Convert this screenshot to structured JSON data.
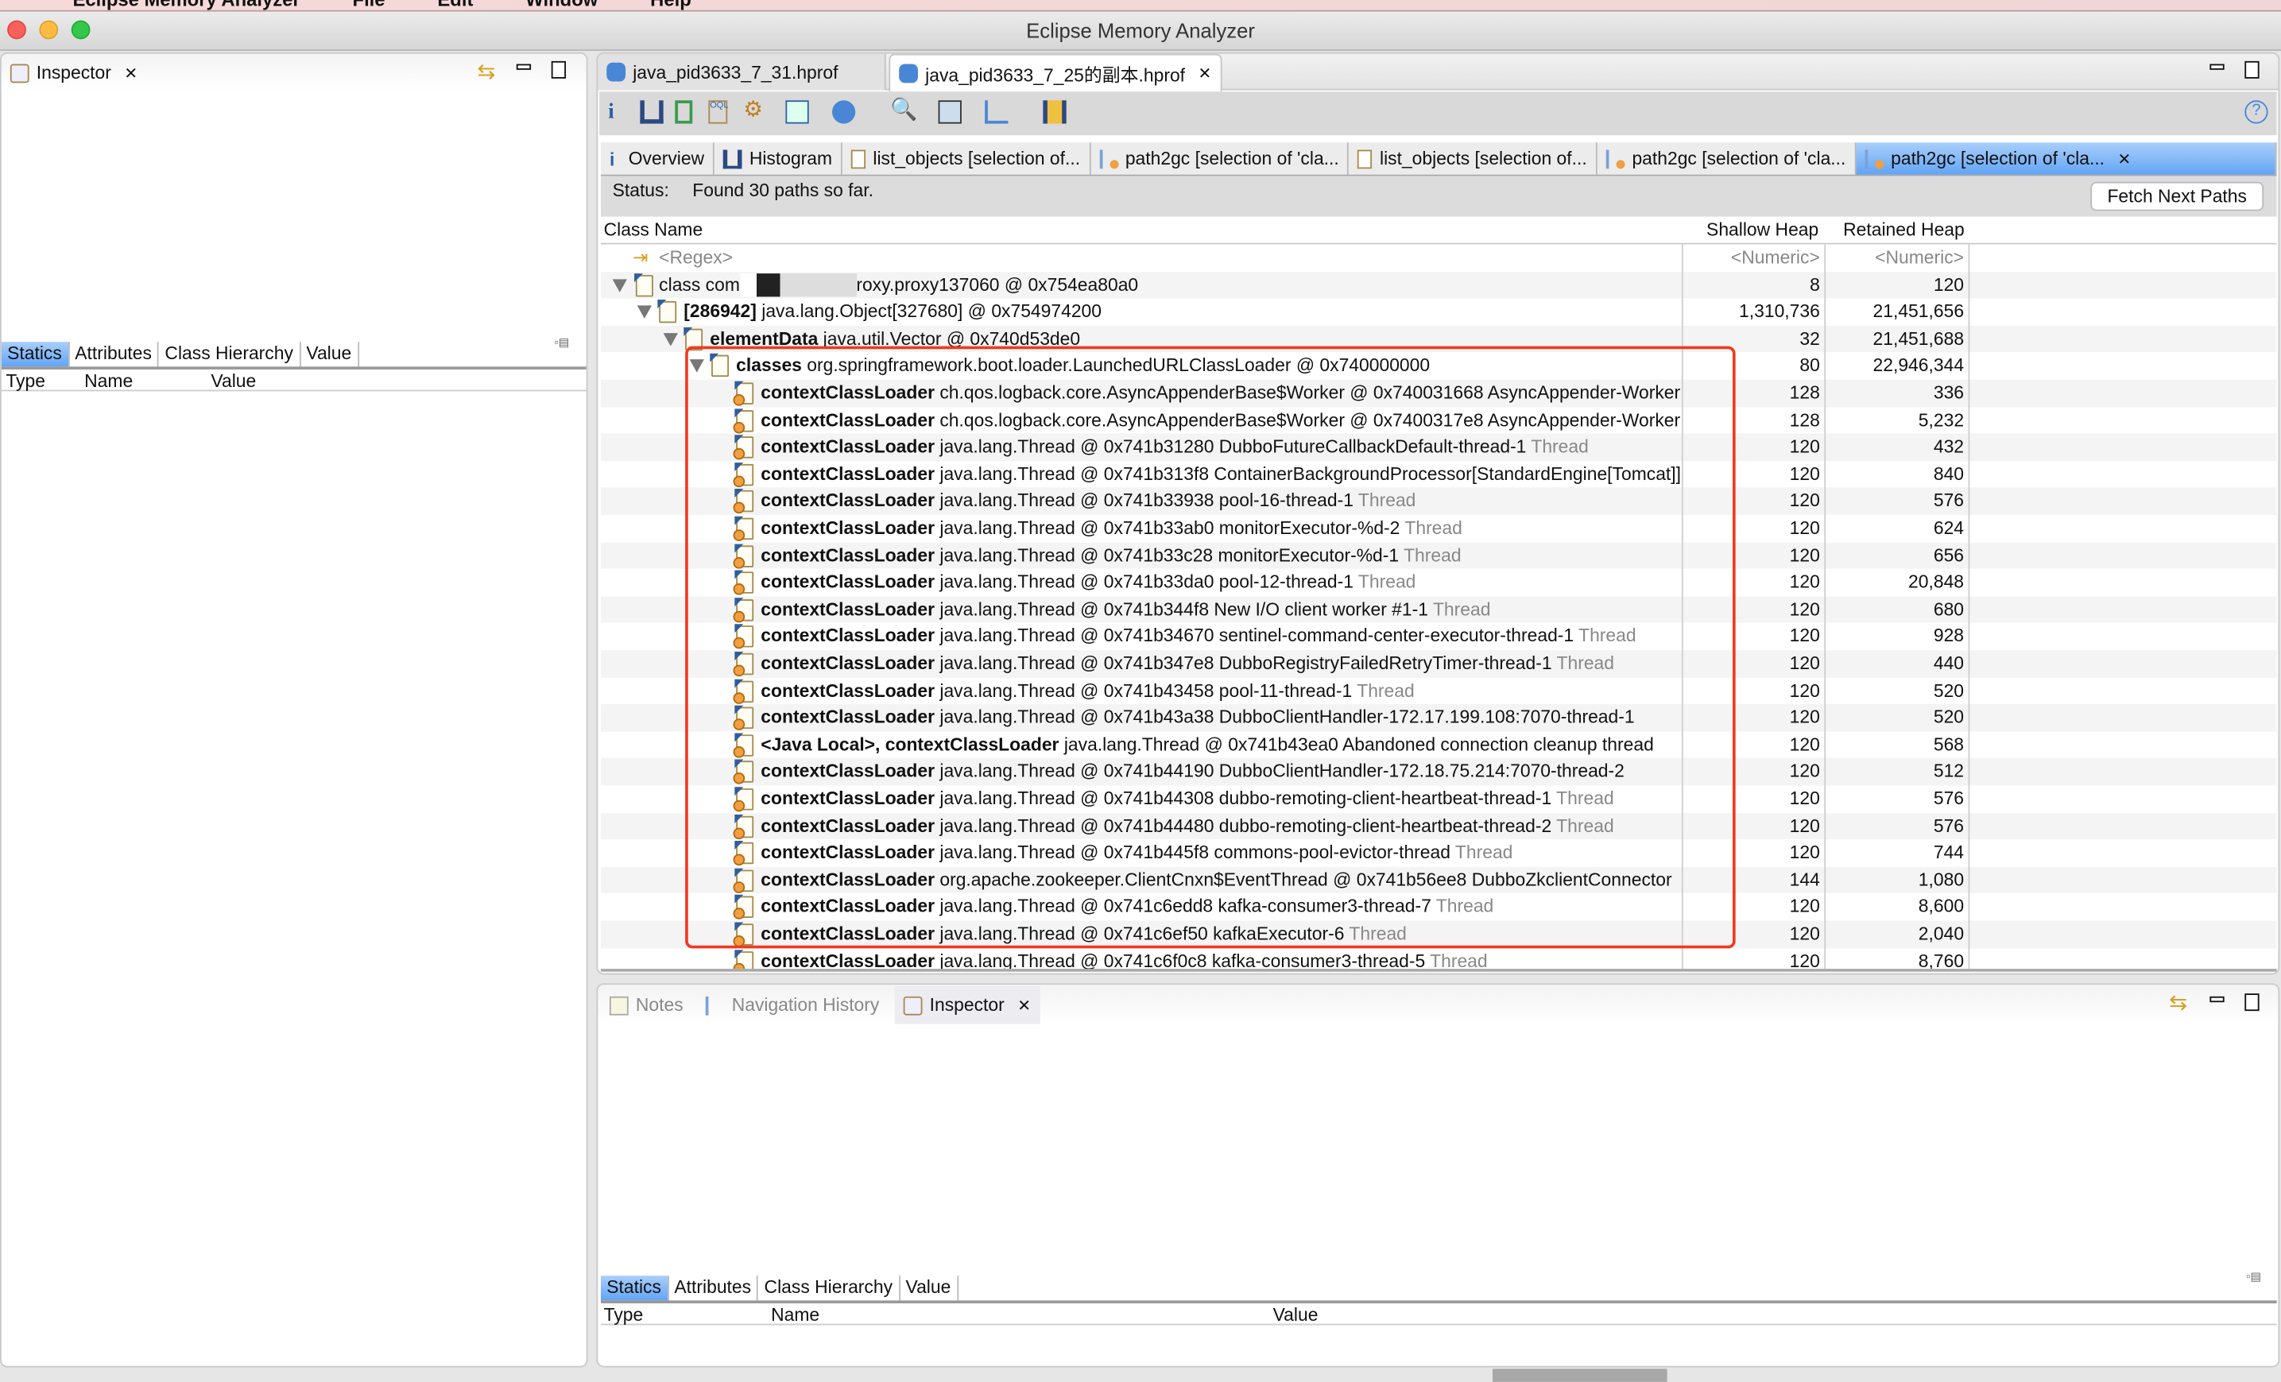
{
  "menubar": {
    "items": [
      "Eclipse Memory Analyzer",
      "File",
      "Edit",
      "Window",
      "Help"
    ]
  },
  "window": {
    "title": "Eclipse Memory Analyzer"
  },
  "left_panel": {
    "tab": "Inspector",
    "subtabs": [
      "Statics",
      "Attributes",
      "Class Hierarchy",
      "Value"
    ],
    "columns": [
      "Type",
      "Name",
      "Value"
    ]
  },
  "editor": {
    "tabs": [
      {
        "label": "java_pid3633_7_31.hprof",
        "active": false
      },
      {
        "label": "java_pid3633_7_25的副本.hprof",
        "active": true
      }
    ],
    "toolbar": [
      "info-icon",
      "histogram-icon",
      "dominator-tree-icon",
      "oql-icon",
      "heap-dump-overview-icon",
      "query-browser-icon",
      "object-query-icon",
      "search-icon",
      "calculator-icon",
      "export-icon",
      "leak-suspects-icon",
      "help-icon"
    ],
    "result_tabs": [
      {
        "label": "Overview",
        "icon": "info-icon"
      },
      {
        "label": "Histogram",
        "icon": "histogram-icon"
      },
      {
        "label": "list_objects  [selection of...",
        "icon": "list-icon"
      },
      {
        "label": "path2gc  [selection of 'cla...",
        "icon": "path-icon"
      },
      {
        "label": "list_objects  [selection of...",
        "icon": "list-icon"
      },
      {
        "label": "path2gc  [selection of 'cla...",
        "icon": "path-icon"
      },
      {
        "label": "path2gc  [selection of 'cla...",
        "icon": "path-icon",
        "active": true
      }
    ],
    "status_label": "Status:",
    "status_text": "Found 30 paths so far.",
    "fetch_button": "Fetch Next Paths",
    "columns": {
      "name": "Class Name",
      "shallow": "Shallow Heap",
      "retained": "Retained Heap"
    },
    "filter": {
      "name": "<Regex>",
      "shallow": "<Numeric>",
      "retained": "<Numeric>"
    },
    "rows": [
      {
        "level": 0,
        "toggle": true,
        "icon": "class",
        "bold": "",
        "text": "class com",
        "redacted": true,
        "text2": "roxy.proxy137060 @ 0x754ea80a0",
        "gray": "",
        "shallow": "8",
        "retained": "120"
      },
      {
        "level": 1,
        "toggle": true,
        "icon": "array",
        "bold": "[286942]",
        "text": " java.lang.Object[327680] @ 0x754974200",
        "gray": "",
        "shallow": "1,310,736",
        "retained": "21,451,656"
      },
      {
        "level": 2,
        "toggle": true,
        "icon": "obj",
        "bold": "elementData",
        "text": " java.util.Vector @ 0x740d53de0",
        "gray": "",
        "shallow": "32",
        "retained": "21,451,688"
      },
      {
        "level": 3,
        "toggle": true,
        "icon": "loader",
        "bold": "classes",
        "text": " org.springframework.boot.loader.LaunchedURLClassLoader @ 0x740000000",
        "gray": "",
        "shallow": "80",
        "retained": "22,946,344"
      },
      {
        "level": 4,
        "bold": "contextClassLoader",
        "text": " ch.qos.logback.core.AsyncAppenderBase$Worker @ 0x740031668  AsyncAppender-Worker",
        "gray": "",
        "shallow": "128",
        "retained": "336"
      },
      {
        "level": 4,
        "bold": "contextClassLoader",
        "text": " ch.qos.logback.core.AsyncAppenderBase$Worker @ 0x7400317e8  AsyncAppender-Worker",
        "gray": "",
        "shallow": "128",
        "retained": "5,232"
      },
      {
        "level": 4,
        "bold": "contextClassLoader",
        "text": " java.lang.Thread @ 0x741b31280  DubboFutureCallbackDefault-thread-1 ",
        "gray": "Thread",
        "shallow": "120",
        "retained": "432"
      },
      {
        "level": 4,
        "bold": "contextClassLoader",
        "text": " java.lang.Thread @ 0x741b313f8  ContainerBackgroundProcessor[StandardEngine[Tomcat]]",
        "gray": "",
        "shallow": "120",
        "retained": "840"
      },
      {
        "level": 4,
        "bold": "contextClassLoader",
        "text": " java.lang.Thread @ 0x741b33938  pool-16-thread-1 ",
        "gray": "Thread",
        "shallow": "120",
        "retained": "576"
      },
      {
        "level": 4,
        "bold": "contextClassLoader",
        "text": " java.lang.Thread @ 0x741b33ab0  monitorExecutor-%d-2 ",
        "gray": "Thread",
        "shallow": "120",
        "retained": "624"
      },
      {
        "level": 4,
        "bold": "contextClassLoader",
        "text": " java.lang.Thread @ 0x741b33c28  monitorExecutor-%d-1 ",
        "gray": "Thread",
        "shallow": "120",
        "retained": "656"
      },
      {
        "level": 4,
        "bold": "contextClassLoader",
        "text": " java.lang.Thread @ 0x741b33da0  pool-12-thread-1 ",
        "gray": "Thread",
        "shallow": "120",
        "retained": "20,848"
      },
      {
        "level": 4,
        "bold": "contextClassLoader",
        "text": " java.lang.Thread @ 0x741b344f8  New I/O client worker #1-1 ",
        "gray": "Thread",
        "shallow": "120",
        "retained": "680"
      },
      {
        "level": 4,
        "bold": "contextClassLoader",
        "text": " java.lang.Thread @ 0x741b34670  sentinel-command-center-executor-thread-1 ",
        "gray": "Thread",
        "shallow": "120",
        "retained": "928"
      },
      {
        "level": 4,
        "bold": "contextClassLoader",
        "text": " java.lang.Thread @ 0x741b347e8  DubboRegistryFailedRetryTimer-thread-1 ",
        "gray": "Thread",
        "shallow": "120",
        "retained": "440"
      },
      {
        "level": 4,
        "bold": "contextClassLoader",
        "text": " java.lang.Thread @ 0x741b43458  pool-11-thread-1 ",
        "gray": "Thread",
        "shallow": "120",
        "retained": "520"
      },
      {
        "level": 4,
        "bold": "contextClassLoader",
        "text": " java.lang.Thread @ 0x741b43a38  DubboClientHandler-172.17.199.108:7070-thread-1",
        "gray": "",
        "shallow": "120",
        "retained": "520"
      },
      {
        "level": 4,
        "bold": "<Java Local>, contextClassLoader",
        "text": " java.lang.Thread @ 0x741b43ea0  Abandoned connection cleanup thread",
        "gray": "",
        "shallow": "120",
        "retained": "568"
      },
      {
        "level": 4,
        "bold": "contextClassLoader",
        "text": " java.lang.Thread @ 0x741b44190  DubboClientHandler-172.18.75.214:7070-thread-2",
        "gray": "",
        "shallow": "120",
        "retained": "512"
      },
      {
        "level": 4,
        "bold": "contextClassLoader",
        "text": " java.lang.Thread @ 0x741b44308  dubbo-remoting-client-heartbeat-thread-1 ",
        "gray": "Thread",
        "shallow": "120",
        "retained": "576"
      },
      {
        "level": 4,
        "bold": "contextClassLoader",
        "text": " java.lang.Thread @ 0x741b44480  dubbo-remoting-client-heartbeat-thread-2 ",
        "gray": "Thread",
        "shallow": "120",
        "retained": "576"
      },
      {
        "level": 4,
        "bold": "contextClassLoader",
        "text": " java.lang.Thread @ 0x741b445f8  commons-pool-evictor-thread ",
        "gray": "Thread",
        "shallow": "120",
        "retained": "744"
      },
      {
        "level": 4,
        "bold": "contextClassLoader",
        "text": " org.apache.zookeeper.ClientCnxn$EventThread @ 0x741b56ee8  DubboZkclientConnector",
        "gray": "",
        "shallow": "144",
        "retained": "1,080"
      },
      {
        "level": 4,
        "bold": "contextClassLoader",
        "text": " java.lang.Thread @ 0x741c6edd8  kafka-consumer3-thread-7 ",
        "gray": "Thread",
        "shallow": "120",
        "retained": "8,600"
      },
      {
        "level": 4,
        "bold": "contextClassLoader",
        "text": " java.lang.Thread @ 0x741c6ef50  kafkaExecutor-6 ",
        "gray": "Thread",
        "shallow": "120",
        "retained": "2,040"
      },
      {
        "level": 4,
        "bold": "contextClassLoader",
        "text": " java.lang.Thread @ 0x741c6f0c8  kafka-consumer3-thread-5 ",
        "gray": "Thread",
        "shallow": "120",
        "retained": "8,760"
      }
    ]
  },
  "bottom_panel": {
    "tabs": [
      {
        "label": "Notes"
      },
      {
        "label": "Navigation History"
      },
      {
        "label": "Inspector",
        "active": true
      }
    ],
    "subtabs": [
      "Statics",
      "Attributes",
      "Class Hierarchy",
      "Value"
    ],
    "columns": [
      "Type",
      "Name",
      "Value"
    ]
  },
  "colors": {
    "highlight_box": "#f2391f",
    "active_tab": "#62a4f5"
  }
}
